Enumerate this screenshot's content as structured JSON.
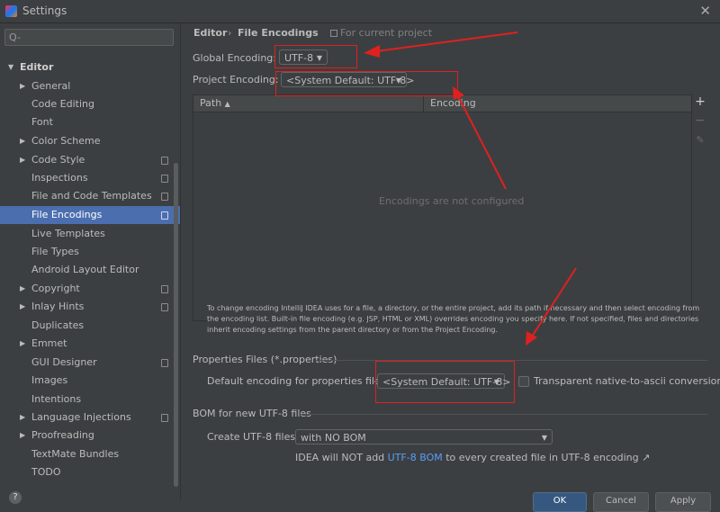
{
  "window": {
    "title": "Settings"
  },
  "sidebar": {
    "search_placeholder": "Q-",
    "items": [
      {
        "label": "Editor"
      },
      {
        "label": "General"
      },
      {
        "label": "Code Editing"
      },
      {
        "label": "Font"
      },
      {
        "label": "Color Scheme"
      },
      {
        "label": "Code Style"
      },
      {
        "label": "Inspections"
      },
      {
        "label": "File and Code Templates"
      },
      {
        "label": "File Encodings"
      },
      {
        "label": "Live Templates"
      },
      {
        "label": "File Types"
      },
      {
        "label": "Android Layout Editor"
      },
      {
        "label": "Copyright"
      },
      {
        "label": "Inlay Hints"
      },
      {
        "label": "Duplicates"
      },
      {
        "label": "Emmet"
      },
      {
        "label": "GUI Designer"
      },
      {
        "label": "Images"
      },
      {
        "label": "Intentions"
      },
      {
        "label": "Language Injections"
      },
      {
        "label": "Proofreading"
      },
      {
        "label": "TextMate Bundles"
      },
      {
        "label": "TODO"
      }
    ]
  },
  "breadcrumb": {
    "parent": "Editor",
    "separator": "›",
    "current": "File Encodings",
    "scope": "For current project"
  },
  "global_encoding": {
    "label": "Global Encoding:",
    "value": "UTF-8"
  },
  "project_encoding": {
    "label": "Project Encoding:",
    "value": "<System Default: UTF-8>"
  },
  "table": {
    "col_path": "Path",
    "col_encoding": "Encoding",
    "empty_text": "Encodings are not configured"
  },
  "info": {
    "line1": "To change encoding IntelliJ IDEA uses for a file, a directory, or the entire project, add its path if necessary and then select encoding from",
    "line2": "the encoding list. Built-in file encoding (e.g. JSP, HTML or XML) overrides encoding you specify here. If not specified, files and directories",
    "line3": "inherit encoding settings from the parent directory or from the Project Encoding."
  },
  "properties": {
    "section_title": "Properties Files (*.properties)",
    "default_label": "Default encoding for properties files:",
    "default_value": "<System Default: UTF-8>",
    "transparent_label": "Transparent native-to-ascii conversion"
  },
  "bom": {
    "section_title": "BOM for new UTF-8 files",
    "create_label": "Create UTF-8 files:",
    "create_value": "with NO BOM",
    "note_before": "IDEA will NOT add",
    "note_link": "UTF-8 BOM",
    "note_after": "to every created file in UTF-8 encoding ↗"
  },
  "footer": {
    "help": "?",
    "ok": "OK",
    "cancel": "Cancel",
    "apply": "Apply"
  },
  "colors": {
    "bg": "#3c3f41",
    "selection": "#4b6eaf",
    "annotation": "#e02020",
    "link": "#589df6"
  }
}
